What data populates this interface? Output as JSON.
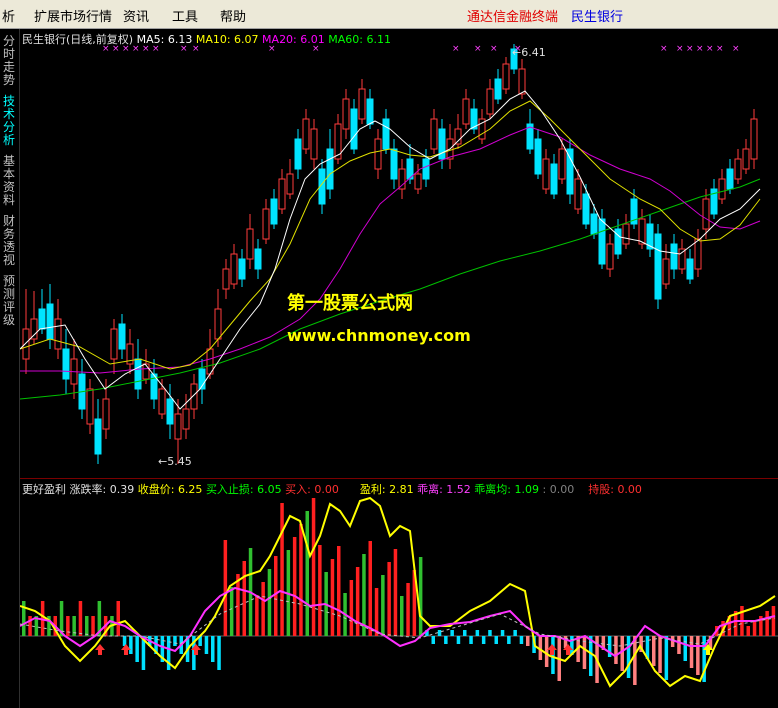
{
  "menubar": {
    "items": [
      "析",
      "扩展市场行情",
      "资讯",
      "工具",
      "帮助"
    ],
    "brand_red": "通达信金融终端",
    "brand_blue": "民生银行"
  },
  "sidebar": {
    "tabs": [
      {
        "label": "分时走势",
        "active": false
      },
      {
        "label": "技术分析",
        "active": true
      },
      {
        "label": "基本资料",
        "active": false
      },
      {
        "label": "财务透视",
        "active": false
      },
      {
        "label": "预测评级",
        "active": false
      }
    ]
  },
  "main_info": {
    "stock": "民生银行(日线,前复权)",
    "ma5_label": "MA5:",
    "ma5_value": "6.13",
    "ma10_label": "MA10:",
    "ma10_value": "6.07",
    "ma20_label": "MA20:",
    "ma20_value": "6.01",
    "ma60_label": "MA60:",
    "ma60_value": "6.11",
    "colors": {
      "ma5": "#ffffff",
      "ma10": "#ffff00",
      "ma20": "#ff00ff",
      "ma60": "#00ff00"
    }
  },
  "price_marks": {
    "high": "6.41",
    "low": "5.45",
    "high_prefix": "←",
    "low_prefix": "←"
  },
  "watermark": {
    "line1": "第一股票公式网",
    "line2": "www.chnmoney.com"
  },
  "sub_info": {
    "name": "更好盈利",
    "rate_label": "涨跌率:",
    "rate_value": "0.39",
    "close_label": "收盘价:",
    "close_value": "6.25",
    "stop_label": "买入止损:",
    "stop_value": "6.05",
    "buy_label": "买入:",
    "buy_value": "0.00",
    "profit_label": "盈利:",
    "profit_value": "2.81",
    "dev_label": "乖离:",
    "dev_value": "1.52",
    "devavg_label": "乖离均:",
    "devavg_value": "1.09",
    "misc_value": ": 0.00",
    "hold_label": "持股:",
    "hold_value": "0.00"
  },
  "chart_data": [
    {
      "type": "candlestick",
      "title": "民生银行(日线,前复权)",
      "high": 6.41,
      "low": 5.45,
      "series": [
        {
          "name": "MA5",
          "value": 6.13
        },
        {
          "name": "MA10",
          "value": 6.07
        },
        {
          "name": "MA20",
          "value": 6.01
        },
        {
          "name": "MA60",
          "value": 6.11
        }
      ]
    },
    {
      "type": "bar",
      "title": "更好盈利",
      "series": [
        {
          "name": "盈利",
          "value": 2.81
        },
        {
          "name": "乖离",
          "value": 1.52
        },
        {
          "name": "乖离均",
          "value": 1.09
        }
      ]
    }
  ]
}
